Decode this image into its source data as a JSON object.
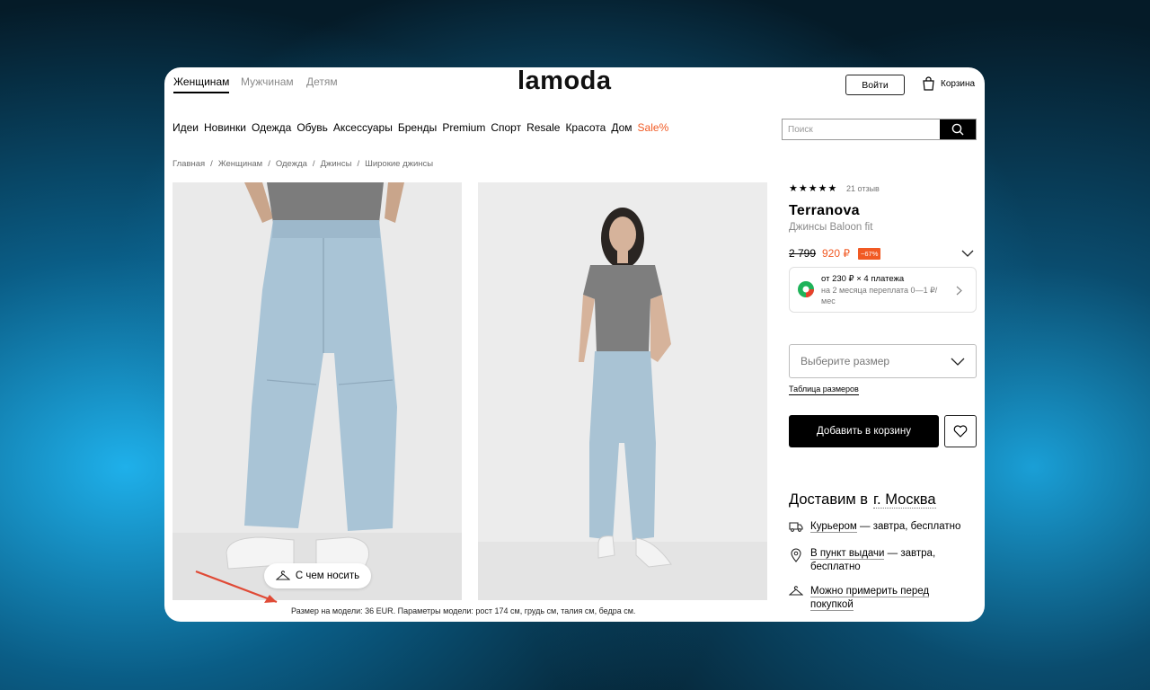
{
  "header": {
    "gender_tabs": [
      "Женщинам",
      "Мужчинам",
      "Детям"
    ],
    "logo": "lamoda",
    "login_label": "Войти",
    "cart_label": "Корзина"
  },
  "nav": {
    "items": [
      "Идеи",
      "Новинки",
      "Одежда",
      "Обувь",
      "Аксессуары",
      "Бренды",
      "Premium",
      "Спорт",
      "Resale",
      "Красота",
      "Дом"
    ],
    "sale_label": "Sale%",
    "sale_color": "#f15a24"
  },
  "search": {
    "placeholder": "Поиск"
  },
  "breadcrumbs": [
    "Главная",
    "Женщинам",
    "Одежда",
    "Джинсы",
    "Широкие джинсы"
  ],
  "gallery": {
    "wear_with_label": "С чем носить",
    "model_info": "Размер на модели: 36 EUR. Параметры модели: рост 174 см, грудь см, талия см, бедра см."
  },
  "product": {
    "stars": "★★★★★",
    "reviews": "21 отзыв",
    "brand": "Terranova",
    "name": "Джинсы Baloon fit",
    "old_price": "2 799",
    "new_price": "920 ₽",
    "discount": "−67%",
    "installment_line1": "от 230 ₽ × 4 платежа",
    "installment_line2": "на 2 месяца переплата 0—1 ₽/мес",
    "size_placeholder": "Выберите размер",
    "size_table_label": "Таблица размеров",
    "add_to_cart_label": "Добавить в корзину"
  },
  "delivery": {
    "title": "Доставим в",
    "city": "г. Москва",
    "courier_link": "Курьером",
    "courier_rest": " — завтра, бесплатно",
    "pickup_link": "В пункт выдачи",
    "pickup_rest": " — завтра,",
    "pickup_line2": "бесплатно",
    "tryon_line1": "Можно примерить перед",
    "tryon_line2": "покупкой"
  }
}
